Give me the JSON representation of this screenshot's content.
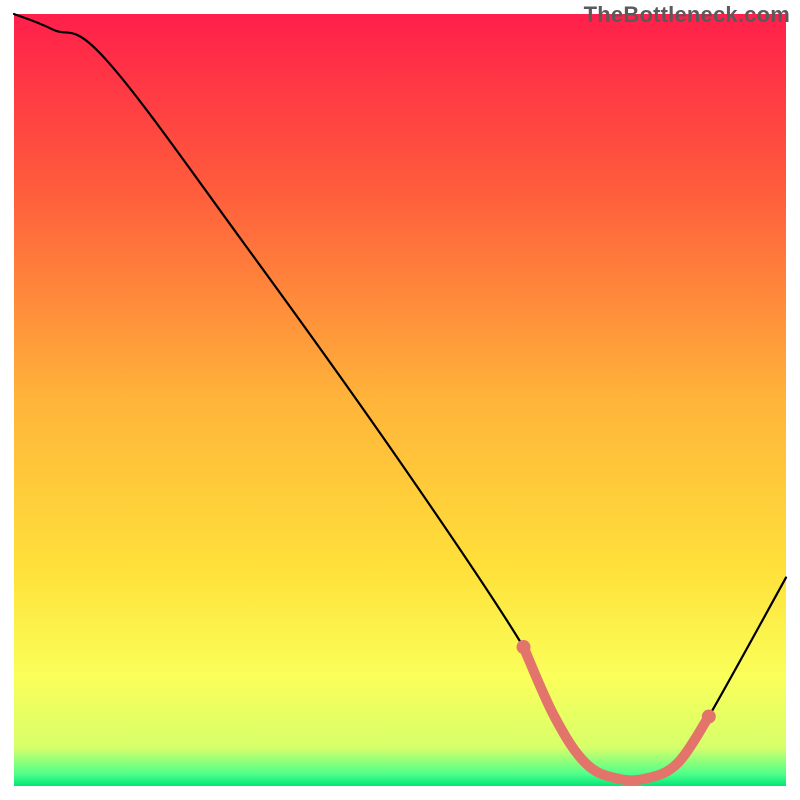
{
  "watermark": "TheBottleneck.com",
  "chart_data": {
    "type": "line",
    "title": "",
    "xlabel": "",
    "ylabel": "",
    "ylim": [
      0,
      100
    ],
    "xlim": [
      0,
      100
    ],
    "grid": false,
    "series": [
      {
        "name": "bottleneck-curve",
        "x": [
          0,
          5,
          12,
          30,
          50,
          66,
          70,
          74,
          78,
          82,
          86,
          90,
          100
        ],
        "y": [
          100,
          98,
          94,
          70,
          42,
          18,
          9,
          3,
          1,
          1,
          3,
          9,
          27
        ]
      }
    ],
    "highlight_band": {
      "name": "optimal-range",
      "x": [
        66,
        70,
        74,
        78,
        82,
        86,
        90
      ],
      "y": [
        18,
        9,
        3,
        1,
        1,
        3,
        9
      ],
      "color": "#e3746c"
    },
    "gradient_stops": [
      {
        "offset": 0.0,
        "color": "#ff1f4b"
      },
      {
        "offset": 0.22,
        "color": "#ff5a3c"
      },
      {
        "offset": 0.5,
        "color": "#ffb43a"
      },
      {
        "offset": 0.72,
        "color": "#ffe13a"
      },
      {
        "offset": 0.86,
        "color": "#faff5a"
      },
      {
        "offset": 0.95,
        "color": "#d7ff6a"
      },
      {
        "offset": 0.985,
        "color": "#4dff8a"
      },
      {
        "offset": 1.0,
        "color": "#00e676"
      }
    ]
  }
}
